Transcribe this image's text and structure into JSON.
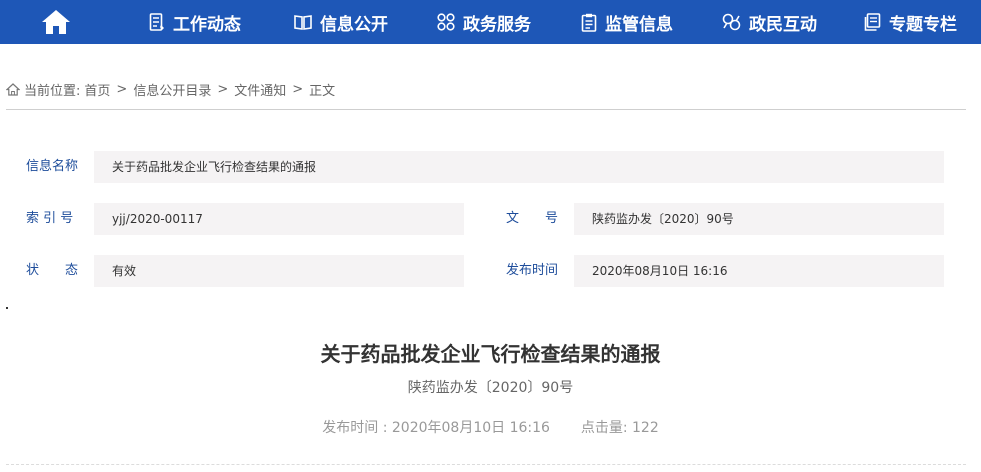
{
  "nav": {
    "items": [
      {
        "label": "工作动态",
        "icon": "document-list-icon"
      },
      {
        "label": "信息公开",
        "icon": "open-book-icon"
      },
      {
        "label": "政务服务",
        "icon": "grid-rings-icon"
      },
      {
        "label": "监管信息",
        "icon": "clipboard-icon"
      },
      {
        "label": "政民互动",
        "icon": "interaction-icon"
      },
      {
        "label": "专题专栏",
        "icon": "file-stack-icon"
      }
    ],
    "home_icon": "home-icon",
    "bar_color": "#1e57b7"
  },
  "breadcrumb": {
    "prefix": "当前位置:",
    "items": [
      "首页",
      "信息公开目录",
      "文件通知",
      "正文"
    ],
    "separator": ">"
  },
  "info": {
    "name_label": "信息名称",
    "name_value": "关于药品批发企业飞行检查结果的通报",
    "index_label": "索 引 号",
    "index_value": "yjj/2020-00117",
    "docno_label": "文　　号",
    "docno_value": "陕药监办发〔2020〕90号",
    "status_label": "状　　态",
    "status_value": "有效",
    "date_label": "发布时间",
    "date_value": "2020年08月10日 16:16"
  },
  "article": {
    "title": "关于药品批发企业飞行检查结果的通报",
    "doc_number": "陕药监办发〔2020〕90号",
    "publish_label": "发布时间 :",
    "publish_time": "2020年08月10日 16:16",
    "views_label": "点击量:",
    "views": "122"
  }
}
